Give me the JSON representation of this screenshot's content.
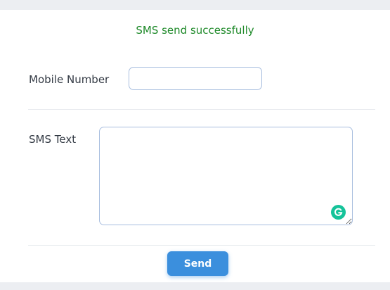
{
  "status": {
    "message": "SMS send successfully",
    "color": "#1f8a2a"
  },
  "form": {
    "mobile_label": "Mobile Number",
    "mobile_value": "",
    "mobile_placeholder": "",
    "sms_label": "SMS Text",
    "sms_value": "",
    "sms_placeholder": ""
  },
  "actions": {
    "send_label": "Send",
    "accent": "#3b8fdd"
  },
  "icons": {
    "grammarly": "grammarly-g-icon",
    "resize": "resize-grip-icon"
  }
}
